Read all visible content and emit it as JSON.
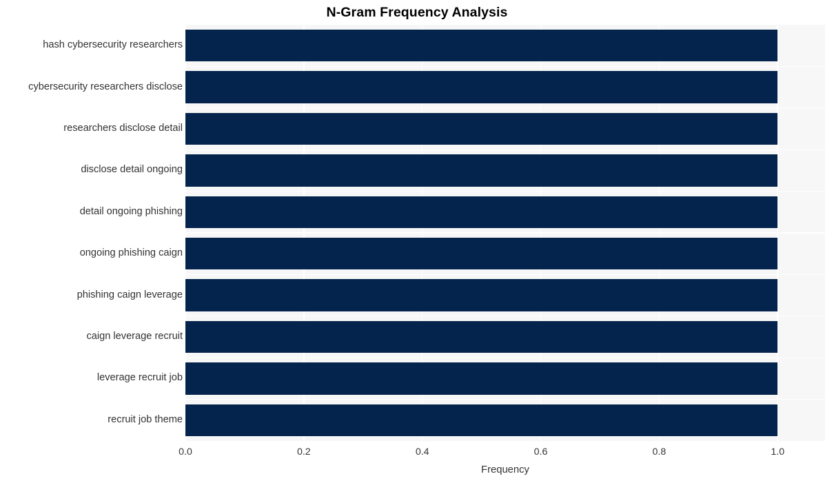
{
  "chart_data": {
    "type": "bar",
    "orientation": "horizontal",
    "title": "N-Gram Frequency Analysis",
    "xlabel": "Frequency",
    "ylabel": "",
    "categories": [
      "hash cybersecurity researchers",
      "cybersecurity researchers disclose",
      "researchers disclose detail",
      "disclose detail ongoing",
      "detail ongoing phishing",
      "ongoing phishing caign",
      "phishing caign leverage",
      "caign leverage recruit",
      "leverage recruit job",
      "recruit job theme"
    ],
    "values": [
      1.0,
      1.0,
      1.0,
      1.0,
      1.0,
      1.0,
      1.0,
      1.0,
      1.0,
      1.0
    ],
    "xlim": [
      0.0,
      1.08
    ],
    "xticks": [
      0.0,
      0.2,
      0.4,
      0.6,
      0.8,
      1.0
    ],
    "xtick_labels": [
      "0.0",
      "0.2",
      "0.4",
      "0.6",
      "0.8",
      "1.0"
    ],
    "grid": true,
    "legend": null,
    "bar_color": "#04244d",
    "plot_background": "#f7f7f7",
    "gridline_color": "#ffffff",
    "figure_background": "#ffffff",
    "text_color": "#333333",
    "title_color": "#000000"
  }
}
